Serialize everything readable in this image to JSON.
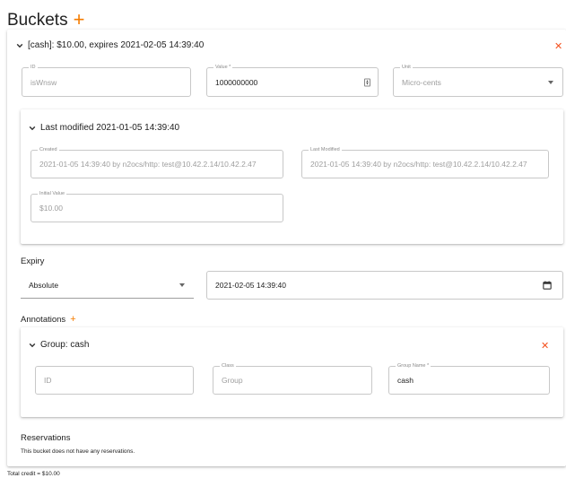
{
  "page": {
    "title": "Buckets"
  },
  "bucket": {
    "header": "[cash]: $10.00, expires 2021-02-05 14:39:40",
    "id": {
      "label": "ID",
      "value": "isWnsw"
    },
    "value": {
      "label": "Value *",
      "value": "1000000000"
    },
    "unit": {
      "label": "Unit",
      "value": "Micro-cents"
    },
    "last_modified": {
      "header": "Last modified 2021-01-05 14:39:40",
      "created": {
        "label": "Created",
        "value": "2021-01-05 14:39:40 by n2ocs/http: test@10.42.2.14/10.42.2.47"
      },
      "modified": {
        "label": "Last Modified",
        "value": "2021-01-05 14:39:40 by n2ocs/http: test@10.42.2.14/10.42.2.47"
      },
      "initial_value": {
        "label": "Initial Value",
        "value": "$10.00"
      }
    },
    "expiry": {
      "label": "Expiry",
      "type_value": "Absolute",
      "date_value": "2021-02-05 14:39:40"
    },
    "annotations": {
      "label": "Annotations",
      "group": {
        "header": "Group: cash",
        "id_placeholder": "ID",
        "class": {
          "label": "Class",
          "placeholder": "Group"
        },
        "group_name": {
          "label": "Group Name *",
          "value": "cash"
        }
      }
    },
    "reservations": {
      "label": "Reservations",
      "empty_text": "This bucket does not have any reservations."
    }
  },
  "footer": {
    "total_credit": "Total credit = $10.00"
  },
  "colors": {
    "accent": "#f57c00",
    "close": "#f4511e"
  }
}
